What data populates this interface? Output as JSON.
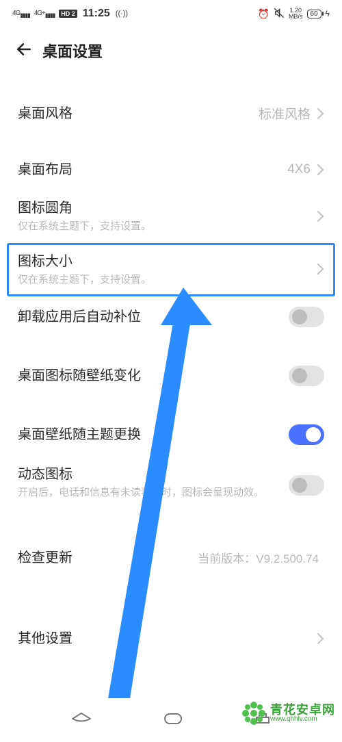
{
  "status": {
    "signal1": "4G",
    "signal2": "4G+",
    "hd": "HD 2",
    "time": "11:25",
    "wifi_hint": "((·))",
    "alarm": "⏰",
    "mute": "🔕",
    "speed_top": "1.20",
    "speed_bot": "MB/s",
    "battery": "60",
    "charging": "⚡"
  },
  "header": {
    "title": "桌面设置"
  },
  "items": {
    "style": {
      "title": "桌面风格",
      "value": "标准风格"
    },
    "layout": {
      "title": "桌面布局",
      "value": "4X6"
    },
    "corner": {
      "title": "图标圆角",
      "sub": "仅在系统主题下，支持设置。"
    },
    "size": {
      "title": "图标大小",
      "sub": "仅在系统主题下，支持设置。"
    },
    "autofill": {
      "title": "卸载应用后自动补位"
    },
    "iconWall": {
      "title": "桌面图标随壁纸变化"
    },
    "wallTheme": {
      "title": "桌面壁纸随主题更换"
    },
    "dynamic": {
      "title": "动态图标",
      "sub": "开启后，电话和信息有未读事件时，图标会呈现动效。"
    },
    "update": {
      "title": "检查更新",
      "value": "当前版本：V9.2.500.74"
    },
    "other": {
      "title": "其他设置"
    }
  },
  "watermark": {
    "cn": "青花安卓网",
    "en": "www.qhhlv.com"
  }
}
